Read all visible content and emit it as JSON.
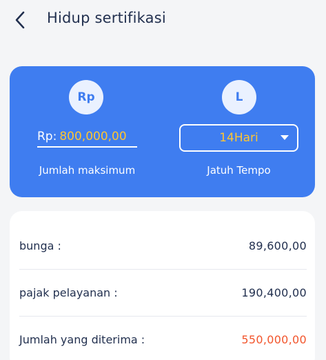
{
  "header": {
    "title": "Hidup sertifikasi"
  },
  "calculator": {
    "amount_icon": "Rp",
    "term_icon": "L",
    "amount_prefix": "Rp:",
    "amount_value": "800,000,00",
    "amount_label": "Jumlah maksimum",
    "term_value": "14Hari",
    "term_label": "Jatuh Tempo"
  },
  "summary": {
    "rows": [
      {
        "label": "bunga :",
        "value": "89,600,00"
      },
      {
        "label": "pajak pelayanan :",
        "value": "190,400,00"
      },
      {
        "label": "Jumlah yang diterima :",
        "value": "550,000,00"
      }
    ]
  },
  "colors": {
    "primary": "#3f7df0",
    "amount_text": "#ffc531",
    "received_text": "#f2552c"
  }
}
